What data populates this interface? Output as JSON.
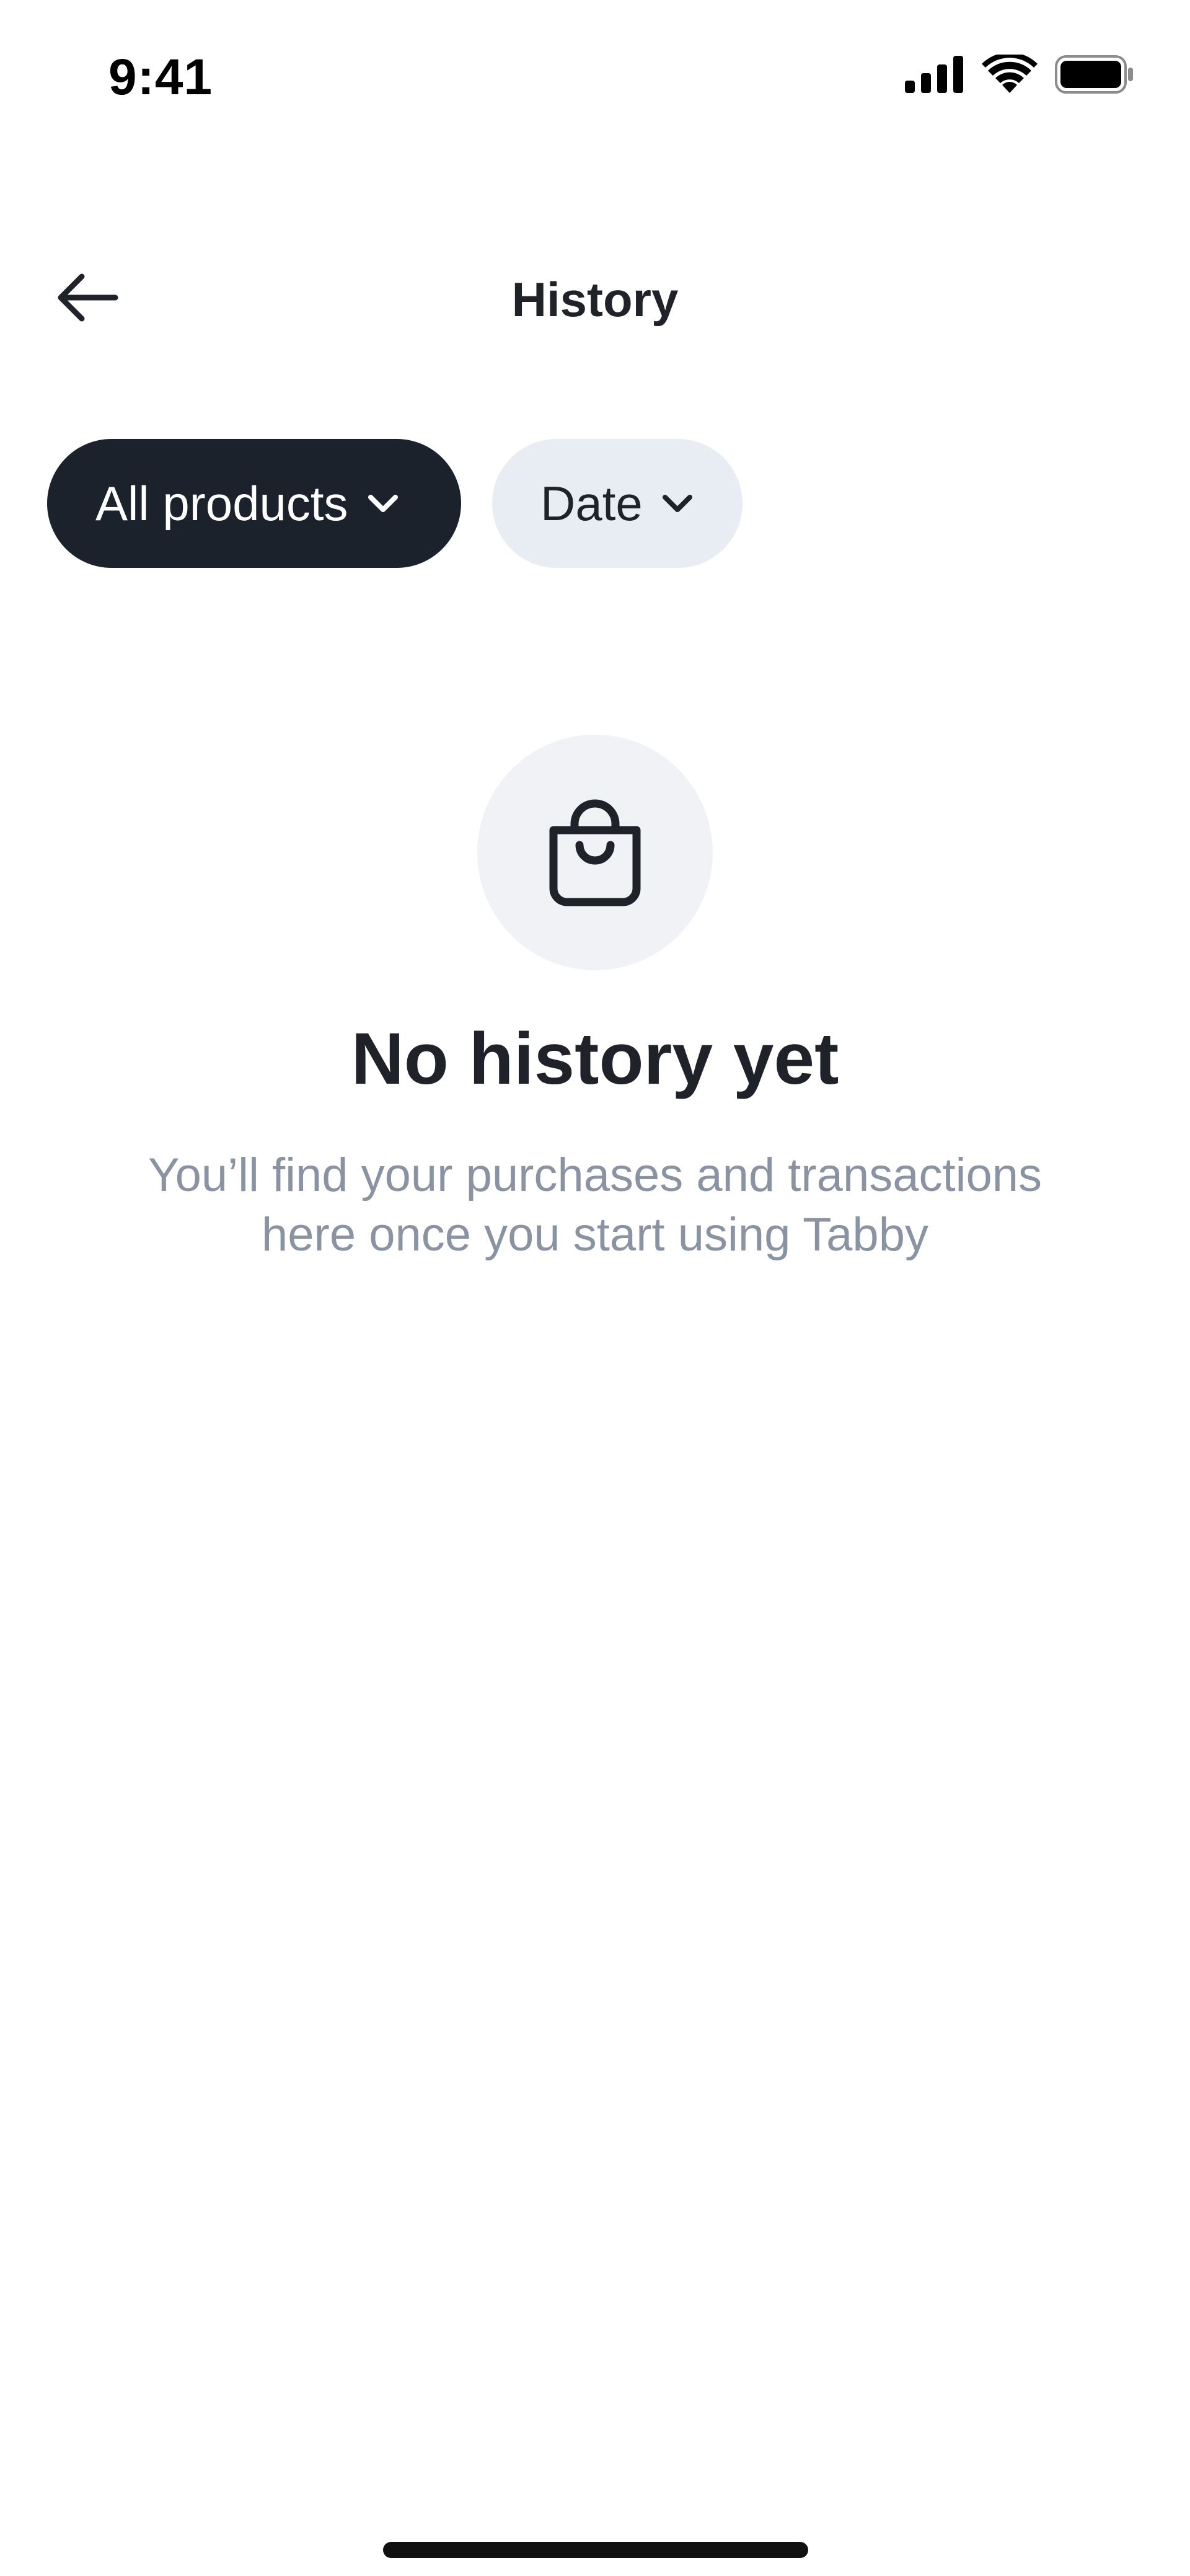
{
  "status_bar": {
    "time": "9:41",
    "icons": [
      "signal-icon",
      "wifi-icon",
      "battery-icon"
    ]
  },
  "header": {
    "title": "History",
    "back_icon": "arrow-left-icon"
  },
  "filters": {
    "products_label": "All products",
    "date_label": "Date",
    "chevron_icon": "chevron-down-icon"
  },
  "empty_state": {
    "icon": "shopping-bag-icon",
    "title": "No history yet",
    "subtitle_line1": "You’ll find your purchases and transactions",
    "subtitle_line2": "here once you start using Tabby"
  },
  "colors": {
    "chip_active_bg": "#1c222b",
    "chip_inactive_bg": "#e8ecf3",
    "text_primary": "#1f2329",
    "text_secondary": "#8a93a1",
    "icon_circle_bg": "#f0f2f5"
  }
}
